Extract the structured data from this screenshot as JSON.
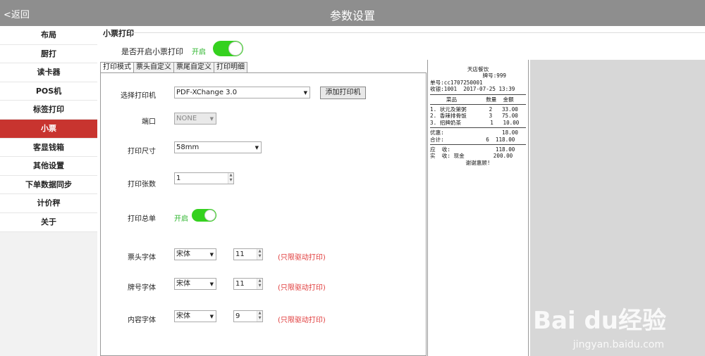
{
  "header": {
    "back_label": "<返回",
    "title": "参数设置"
  },
  "sidebar": {
    "items": [
      {
        "label": "布局"
      },
      {
        "label": "厨打"
      },
      {
        "label": "读卡器"
      },
      {
        "label": "POS机"
      },
      {
        "label": "标签打印"
      },
      {
        "label": "小票",
        "active": true
      },
      {
        "label": "客显钱箱"
      },
      {
        "label": "其他设置"
      },
      {
        "label": "下单数据同步"
      },
      {
        "label": "计价秤"
      },
      {
        "label": "关于"
      }
    ]
  },
  "main": {
    "section_title": "小票打印",
    "enable_print": {
      "label": "是否开启小票打印",
      "state_text": "开启",
      "on": true
    },
    "tabs": [
      {
        "label": "打印模式",
        "active": true
      },
      {
        "label": "票头自定义"
      },
      {
        "label": "票尾自定义"
      },
      {
        "label": "打印明细"
      }
    ],
    "form": {
      "printer": {
        "label": "选择打印机",
        "value": "PDF-XChange 3.0",
        "add_button": "添加打印机"
      },
      "port": {
        "label": "端口",
        "value": "NONE"
      },
      "size": {
        "label": "打印尺寸",
        "value": "58mm"
      },
      "copies": {
        "label": "打印张数",
        "value": "1"
      },
      "summary": {
        "label": "打印总单",
        "state_text": "开启",
        "on": true
      },
      "header_font": {
        "label": "票头字体",
        "font": "宋体",
        "size": "11",
        "note": "(只限驱动打印)"
      },
      "number_font": {
        "label": "牌号字体",
        "font": "宋体",
        "size": "11",
        "note": "(只限驱动打印)"
      },
      "content_font": {
        "label": "内容字体",
        "font": "宋体",
        "size": "9",
        "note": "(只限驱动打印)"
      }
    }
  },
  "receipt": {
    "shop": "天店餐饮",
    "table_no": "牌号:999",
    "order_no": "单号:cc1707250001",
    "cashier_time": "收银:1001  2017-07-25 13:39",
    "col_header": "     菜品         数量  金额",
    "items": [
      "1. 状元及第粥       2   33.00",
      "2. 香辣排骨饭       3   75.00",
      "3. 招牌奶茶         1   10.00"
    ],
    "discount": "优惠:                  18.00",
    "total": "合计:             6  118.00",
    "receivable": "应  收:              118.00",
    "received": "实  收: 现金         200.00",
    "thanks": "谢谢惠顾!"
  },
  "watermark": {
    "main": "Bai du经验",
    "sub": "jingyan.baidu.com"
  }
}
